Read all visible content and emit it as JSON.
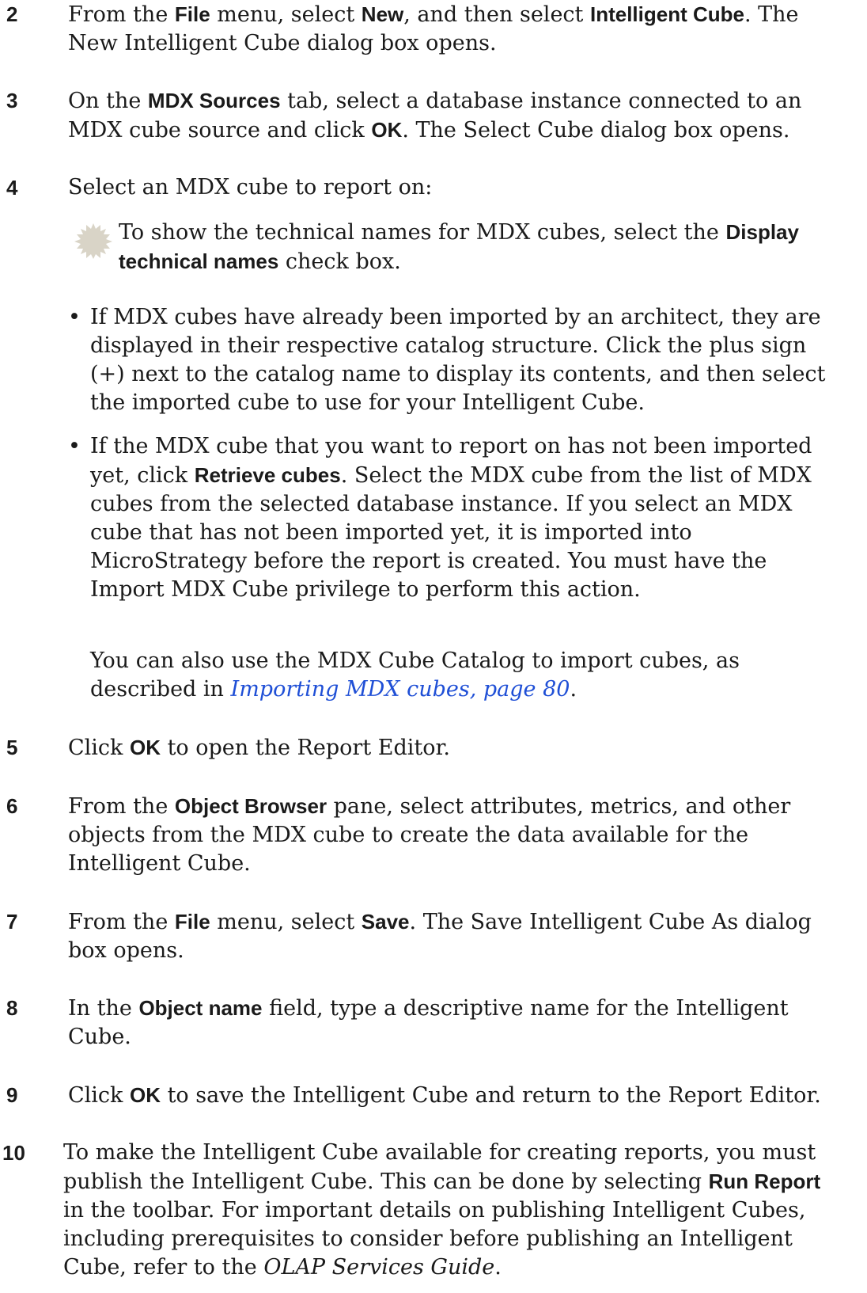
{
  "steps": {
    "s2": {
      "number": "2",
      "t1": "From the ",
      "b1": "File",
      "t2": " menu, select ",
      "b2": "New",
      "t3": ", and then select ",
      "b3": "Intelligent Cube",
      "t4": ". The New Intelligent Cube dialog box opens."
    },
    "s3": {
      "number": "3",
      "t1": "On the ",
      "b1": "MDX Sources",
      "t2": " tab, select a database instance connected to an MDX cube source and click ",
      "b2": "OK",
      "t3": ". The Select Cube dialog box opens."
    },
    "s4": {
      "number": "4",
      "text": "Select an MDX cube to report on:",
      "note": {
        "t1": "To show the technical names for MDX cubes, select the ",
        "b1": "Display technical names",
        "t2": " check box."
      },
      "bullet_char": "•",
      "bullet1": "If MDX cubes have already been imported by an architect, they are displayed in their respective catalog structure. Click the plus sign (+) next to the catalog name to display its contents, and then select the imported cube to use for your Intelligent Cube.",
      "bullet2": {
        "t1": "If the MDX cube that you want to report on has not been imported yet, click ",
        "b1": "Retrieve cubes",
        "t2": ". Select the MDX cube from the list of MDX cubes from the selected database instance. If you select an MDX cube that has not been imported yet, it is imported into MicroStrategy before the report is created. You must have the Import MDX Cube privilege to perform this action."
      },
      "para": {
        "t1": "You can also use the MDX Cube Catalog to import cubes, as described in ",
        "link": "Importing MDX cubes, page 80",
        "t2": "."
      }
    },
    "s5": {
      "number": "5",
      "t1": "Click ",
      "b1": "OK",
      "t2": " to open the Report Editor."
    },
    "s6": {
      "number": "6",
      "t1": "From the ",
      "b1": "Object Browser",
      "t2": " pane, select attributes, metrics, and other objects from the MDX cube to create the data available for the Intelligent Cube."
    },
    "s7": {
      "number": "7",
      "t1": "From the ",
      "b1": "File",
      "t2": " menu, select ",
      "b2": "Save",
      "t3": ". The Save Intelligent Cube As dialog box opens."
    },
    "s8": {
      "number": "8",
      "t1": "In the ",
      "b1": "Object name",
      "t2": " field, type a descriptive name for the Intelligent Cube."
    },
    "s9": {
      "number": "9",
      "t1": "Click ",
      "b1": "OK",
      "t2": " to save the Intelligent Cube and return to the Report Editor."
    },
    "s10": {
      "number": "10",
      "t1": "To make the Intelligent Cube available for creating reports, you must publish the Intelligent Cube. This can be done by selecting ",
      "b1": "Run Report",
      "t2": " in the toolbar. For important details on publishing Intelligent Cubes, including prerequisites to consider before publishing an Intelligent Cube, refer to the ",
      "i1": "OLAP Services Guide",
      "t3": "."
    }
  },
  "colors": {
    "text": "#1a1a1a",
    "link": "#1f4fd6",
    "note_icon": "#d9d4c7"
  },
  "icons": {
    "note": "note-burst-icon"
  }
}
